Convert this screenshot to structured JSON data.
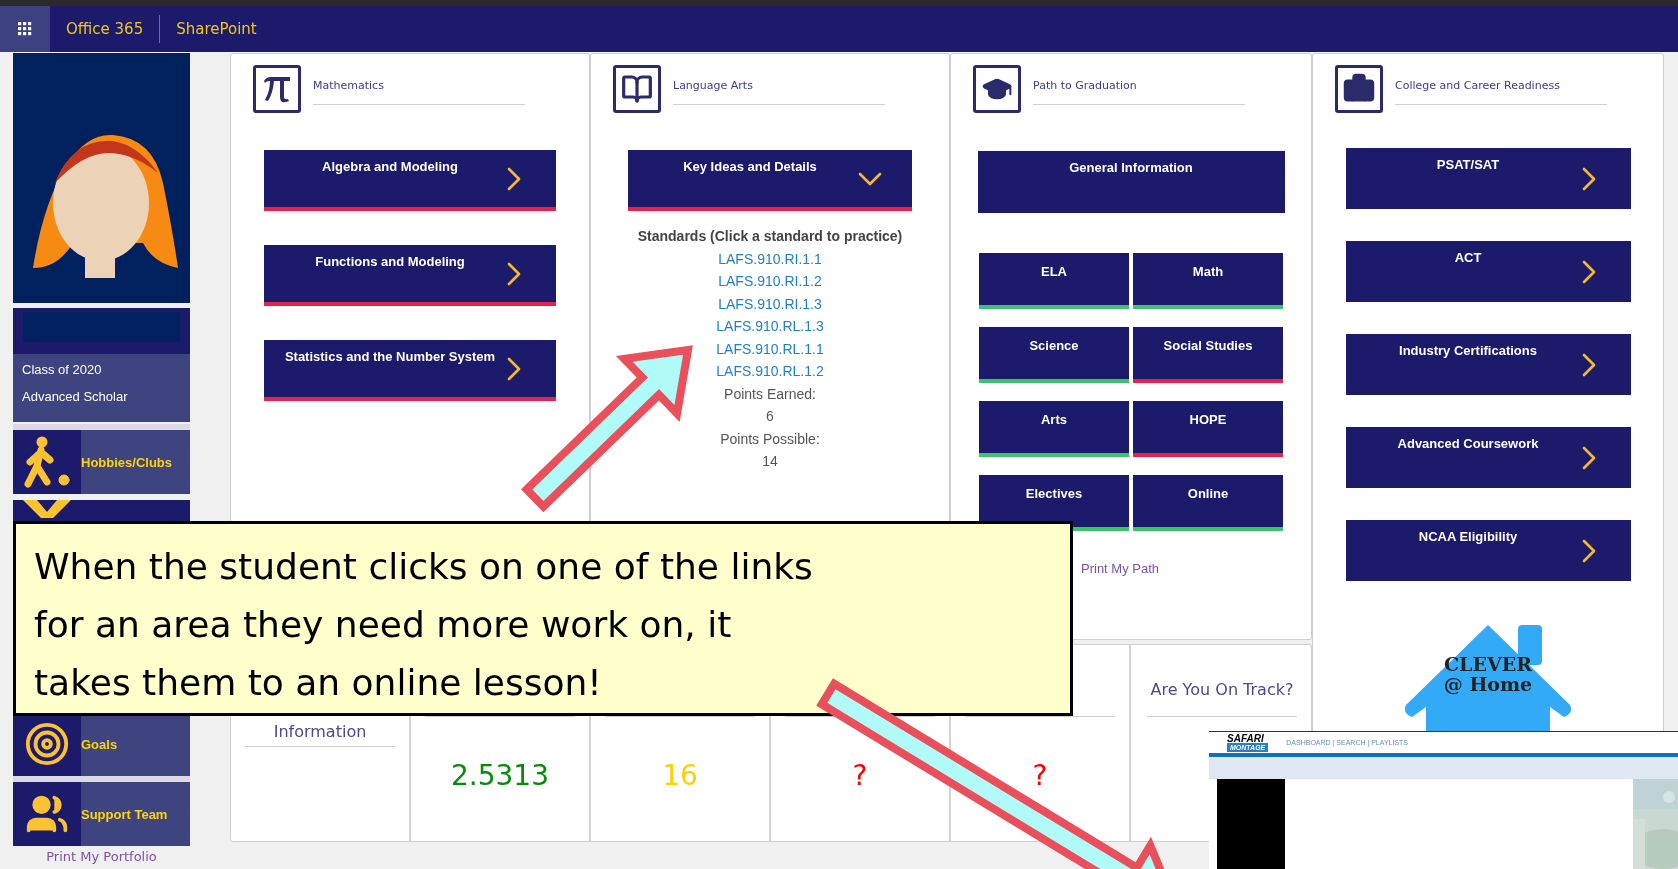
{
  "topbar": {
    "app_name": "Office 365",
    "site_name": "SharePoint"
  },
  "sidebar": {
    "profile": {
      "class_year": "Class of 2020",
      "distinction": "Advanced Scholar"
    },
    "items": [
      {
        "label": "Hobbies/Clubs"
      },
      {
        "label": "Goals"
      },
      {
        "label": "Support Team"
      }
    ],
    "print_link": "Print My Portfolio"
  },
  "mathematics": {
    "title": "Mathematics",
    "buttons": [
      {
        "label": "Algebra and Modeling",
        "expanded": false,
        "color": "#e8204a"
      },
      {
        "label": "Functions and Modeling",
        "expanded": false,
        "color": "#e8204a"
      },
      {
        "label": "Statistics and the Number System",
        "expanded": false,
        "color": "#e8204a"
      }
    ]
  },
  "language_arts": {
    "title": "Language Arts",
    "buttons": [
      {
        "label": "Key Ideas and Details",
        "expanded": true,
        "color": "#e8204a"
      }
    ],
    "standards": {
      "heading": "Standards (Click a standard to practice)",
      "links": [
        "LAFS.910.RI.1.1",
        "LAFS.910.RI.1.2",
        "LAFS.910.RI.1.3",
        "LAFS.910.RL.1.3",
        "LAFS.910.RL.1.1",
        "LAFS.910.RL.1.2"
      ],
      "points_earned_label": "Points Earned:",
      "points_earned": "6",
      "points_possible_label": "Points Possible:",
      "points_possible": "14"
    }
  },
  "path_to_graduation": {
    "title": "Path to Graduation",
    "general_button": "General Information",
    "areas": [
      {
        "label": "ELA",
        "color": "#3cc46a"
      },
      {
        "label": "Math",
        "color": "#3cc46a"
      },
      {
        "label": "Science",
        "color": "#3cc46a"
      },
      {
        "label": "Social Studies",
        "color": "#e8204a"
      },
      {
        "label": "Arts",
        "color": "#3cc46a"
      },
      {
        "label": "HOPE",
        "color": "#e8204a"
      },
      {
        "label": "Electives",
        "color": "#3cc46a"
      },
      {
        "label": "Online",
        "color": "#3cc46a"
      }
    ],
    "print_link": "Print My Path"
  },
  "college_readiness": {
    "title": "College and Career Readiness",
    "buttons": [
      {
        "label": "PSAT/SAT",
        "expanded": false
      },
      {
        "label": "ACT",
        "expanded": false
      },
      {
        "label": "Industry Certifications",
        "expanded": false
      },
      {
        "label": "Advanced Coursework",
        "expanded": false
      },
      {
        "label": "NCAA Eligibility",
        "expanded": false
      }
    ],
    "logo": {
      "line1": "CLEVER",
      "line2": "@ Home"
    }
  },
  "stats": [
    {
      "title": "Information"
    },
    {
      "value": "2.5313",
      "color": "#0a8a0a"
    },
    {
      "value": "16",
      "color": "#ffd000"
    },
    {
      "value": "?",
      "color": "#ff0000"
    },
    {
      "value": "?",
      "color": "#ff0000"
    },
    {
      "title": "Are You On Track?"
    }
  ],
  "callout": {
    "lines": [
      "When the student clicks on one of the links",
      "for an area they need more work on, it",
      "takes them to an online lesson!"
    ]
  },
  "lesson_window": {
    "logo_top": "SAFARI",
    "logo_bottom": "MONTAGE",
    "nav": "DASHBOARD | SEARCH | PLAYLISTS"
  }
}
